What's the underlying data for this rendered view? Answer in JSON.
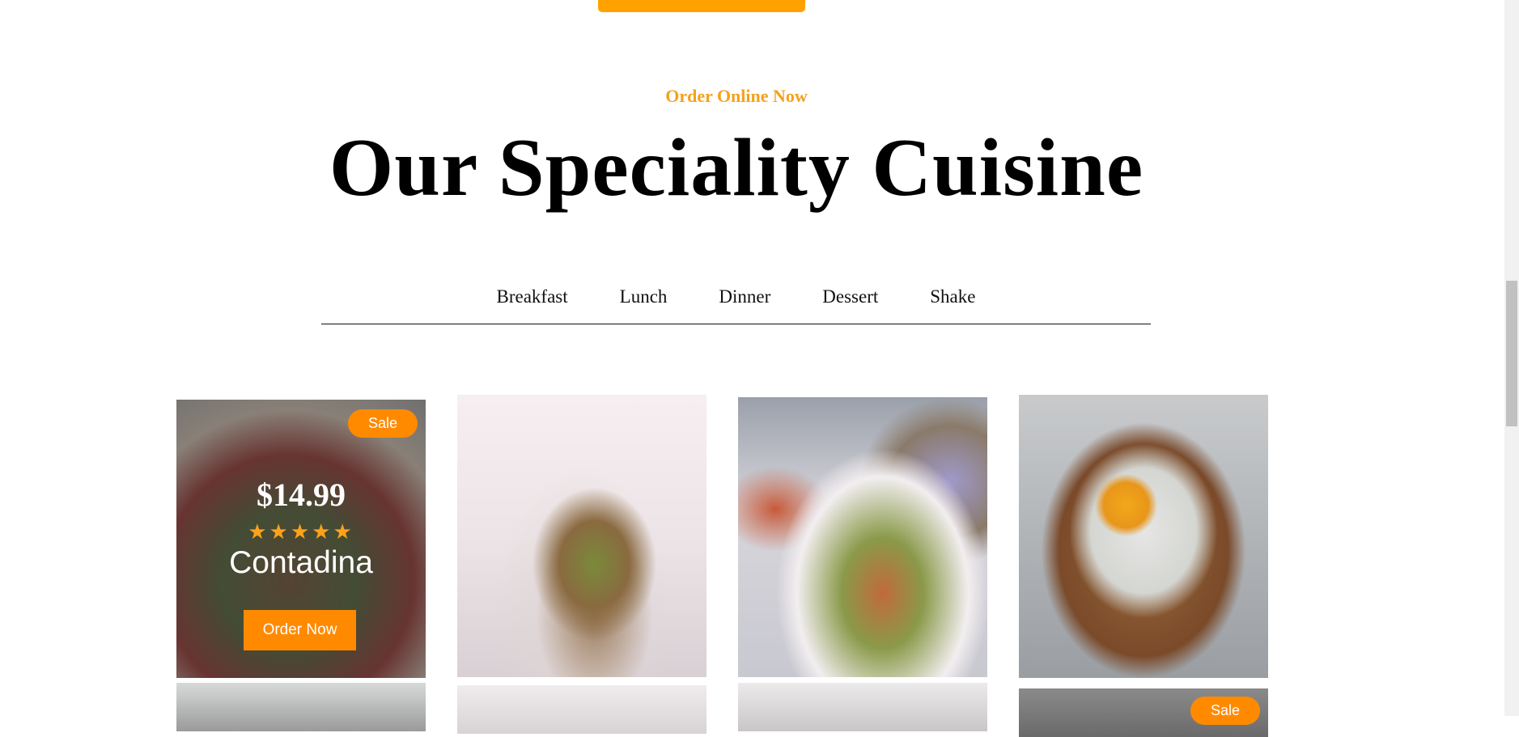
{
  "section": {
    "eyebrow": "Order Online Now",
    "heading": "Our Speciality Cuisine"
  },
  "tabs": [
    "Breakfast",
    "Lunch",
    "Dinner",
    "Dessert",
    "Shake"
  ],
  "featured_card": {
    "sale_badge": "Sale",
    "price": "$14.99",
    "rating_stars": "★★★★★",
    "name": "Contadina",
    "order_button": "Order Now"
  },
  "second_row_sale_badge": "Sale",
  "colors": {
    "accent": "#ffa200",
    "eyebrow": "#f5a11c",
    "order_button": "#ff8a00"
  }
}
